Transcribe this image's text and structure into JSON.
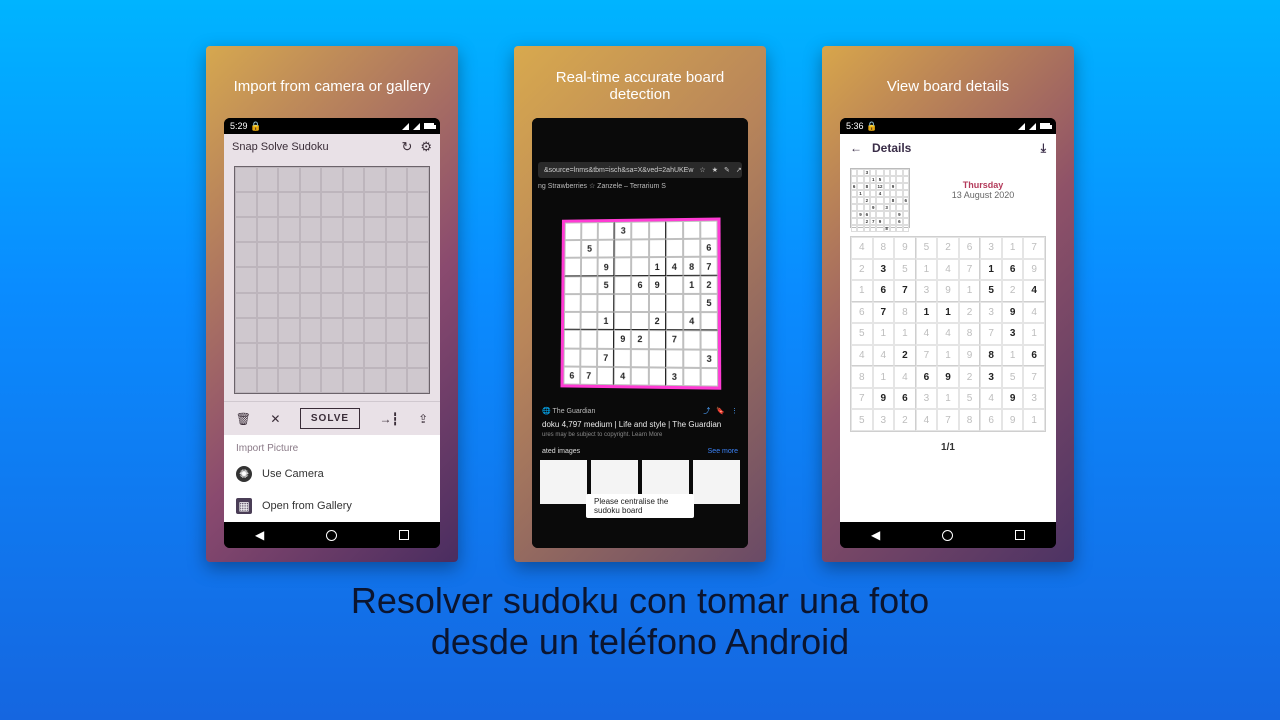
{
  "main_title_l1": "Resolver sudoku  con tomar una foto",
  "main_title_l2": "desde un teléfono Android",
  "slide1": {
    "caption": "Import from camera or gallery",
    "status_time": "5:29",
    "app_title": "Snap Solve Sudoku",
    "solve_label": "SOLVE",
    "sheet_header": "Import Picture",
    "option_camera": "Use Camera",
    "option_gallery": "Open from Gallery"
  },
  "slide2": {
    "caption": "Real-time accurate board detection",
    "url_fragment": "&source=lnms&tbm=isch&sa=X&ved=2ahUKEw",
    "tab_text": "ng Strawberries  ☆  Zanzele – Terrarium S",
    "source": "🌐  The Guardian",
    "headline": "doku 4,797 medium | Life and style | The Guardian",
    "subline": "ures may be subject to copyright.  Learn More",
    "related_label": "ated images",
    "see_more": "See more",
    "toast": "Please centralise the sudoku board",
    "detected_board": [
      [
        "",
        "",
        "",
        "3",
        "",
        "",
        "",
        "",
        ""
      ],
      [
        "",
        "5",
        "",
        "",
        "",
        "",
        "",
        "",
        "6"
      ],
      [
        "",
        "",
        "9",
        "",
        "",
        "1",
        "4",
        "8",
        "7"
      ],
      [
        "",
        "",
        "5",
        "",
        "6",
        "9",
        "",
        "1",
        "2"
      ],
      [
        "",
        "",
        "",
        "",
        "",
        "",
        "",
        "",
        "5"
      ],
      [
        "",
        "",
        "1",
        "",
        "",
        "2",
        "",
        "4",
        ""
      ],
      [
        "",
        "",
        "",
        "9",
        "2",
        "",
        "7",
        "",
        ""
      ],
      [
        "",
        "",
        "7",
        "",
        "",
        "",
        "",
        "",
        "3"
      ],
      [
        "6",
        "7",
        "",
        "4",
        "",
        "",
        "3",
        "",
        ""
      ]
    ]
  },
  "slide3": {
    "caption": "View board details",
    "status_time": "5:36",
    "title": "Details",
    "dow": "Thursday",
    "date": "13 August 2020",
    "pager": "1/1",
    "big_board": [
      [
        {
          "v": "4",
          "g": 0
        },
        {
          "v": "8",
          "g": 0
        },
        {
          "v": "9",
          "g": 0
        },
        {
          "v": "5",
          "g": 0
        },
        {
          "v": "2",
          "g": 0
        },
        {
          "v": "6",
          "g": 0
        },
        {
          "v": "3",
          "g": 0
        },
        {
          "v": "1",
          "g": 0
        },
        {
          "v": "7",
          "g": 0
        }
      ],
      [
        {
          "v": "2",
          "g": 0
        },
        {
          "v": "3",
          "g": 1
        },
        {
          "v": "5",
          "g": 0
        },
        {
          "v": "1",
          "g": 0
        },
        {
          "v": "4",
          "g": 0
        },
        {
          "v": "7",
          "g": 0
        },
        {
          "v": "1",
          "g": 1
        },
        {
          "v": "6",
          "g": 1
        },
        {
          "v": "9",
          "g": 0
        }
      ],
      [
        {
          "v": "1",
          "g": 0
        },
        {
          "v": "6",
          "g": 1
        },
        {
          "v": "7",
          "g": 1
        },
        {
          "v": "3",
          "g": 0
        },
        {
          "v": "9",
          "g": 0
        },
        {
          "v": "1",
          "g": 0
        },
        {
          "v": "5",
          "g": 1
        },
        {
          "v": "2",
          "g": 0
        },
        {
          "v": "4",
          "g": 1
        }
      ],
      [
        {
          "v": "6",
          "g": 0
        },
        {
          "v": "7",
          "g": 1
        },
        {
          "v": "8",
          "g": 0
        },
        {
          "v": "1",
          "g": 1
        },
        {
          "v": "1",
          "g": 1
        },
        {
          "v": "2",
          "g": 0
        },
        {
          "v": "3",
          "g": 0
        },
        {
          "v": "9",
          "g": 1
        },
        {
          "v": "4",
          "g": 0
        }
      ],
      [
        {
          "v": "5",
          "g": 0
        },
        {
          "v": "1",
          "g": 0
        },
        {
          "v": "1",
          "g": 0
        },
        {
          "v": "4",
          "g": 0
        },
        {
          "v": "4",
          "g": 0
        },
        {
          "v": "8",
          "g": 0
        },
        {
          "v": "7",
          "g": 0
        },
        {
          "v": "3",
          "g": 1
        },
        {
          "v": "1",
          "g": 0
        }
      ],
      [
        {
          "v": "4",
          "g": 0
        },
        {
          "v": "4",
          "g": 0
        },
        {
          "v": "2",
          "g": 1
        },
        {
          "v": "7",
          "g": 0
        },
        {
          "v": "1",
          "g": 0
        },
        {
          "v": "9",
          "g": 0
        },
        {
          "v": "8",
          "g": 1
        },
        {
          "v": "1",
          "g": 0
        },
        {
          "v": "6",
          "g": 1
        }
      ],
      [
        {
          "v": "8",
          "g": 0
        },
        {
          "v": "1",
          "g": 0
        },
        {
          "v": "4",
          "g": 0
        },
        {
          "v": "6",
          "g": 1
        },
        {
          "v": "9",
          "g": 1
        },
        {
          "v": "2",
          "g": 0
        },
        {
          "v": "3",
          "g": 1
        },
        {
          "v": "5",
          "g": 0
        },
        {
          "v": "7",
          "g": 0
        }
      ],
      [
        {
          "v": "7",
          "g": 0
        },
        {
          "v": "9",
          "g": 1
        },
        {
          "v": "6",
          "g": 1
        },
        {
          "v": "3",
          "g": 0
        },
        {
          "v": "1",
          "g": 0
        },
        {
          "v": "5",
          "g": 0
        },
        {
          "v": "4",
          "g": 0
        },
        {
          "v": "9",
          "g": 1
        },
        {
          "v": "3",
          "g": 0
        }
      ],
      [
        {
          "v": "5",
          "g": 0
        },
        {
          "v": "3",
          "g": 0
        },
        {
          "v": "2",
          "g": 0
        },
        {
          "v": "4",
          "g": 0
        },
        {
          "v": "7",
          "g": 0
        },
        {
          "v": "8",
          "g": 0
        },
        {
          "v": "6",
          "g": 0
        },
        {
          "v": "9",
          "g": 0
        },
        {
          "v": "1",
          "g": 0
        }
      ]
    ],
    "mini_board": [
      [
        "",
        "",
        "3",
        "",
        "",
        "",
        "",
        "",
        ""
      ],
      [
        "",
        "",
        "",
        "1",
        "5",
        "",
        "",
        "",
        ""
      ],
      [
        "6",
        "",
        "8",
        "",
        "12",
        "",
        "9",
        "",
        ""
      ],
      [
        "",
        "1",
        "",
        "",
        "4",
        "",
        "",
        "",
        ""
      ],
      [
        "",
        "",
        "2",
        "",
        "",
        "",
        "8",
        "",
        "6"
      ],
      [
        "",
        "",
        "",
        "9",
        "",
        "3",
        "",
        "",
        ""
      ],
      [
        "",
        "9",
        "6",
        "",
        "",
        "",
        "",
        "9",
        ""
      ],
      [
        "",
        "",
        "2",
        "7",
        "9",
        "",
        "",
        "6",
        ""
      ],
      [
        "",
        "",
        "",
        "",
        "",
        "8",
        "",
        "",
        ""
      ]
    ]
  }
}
